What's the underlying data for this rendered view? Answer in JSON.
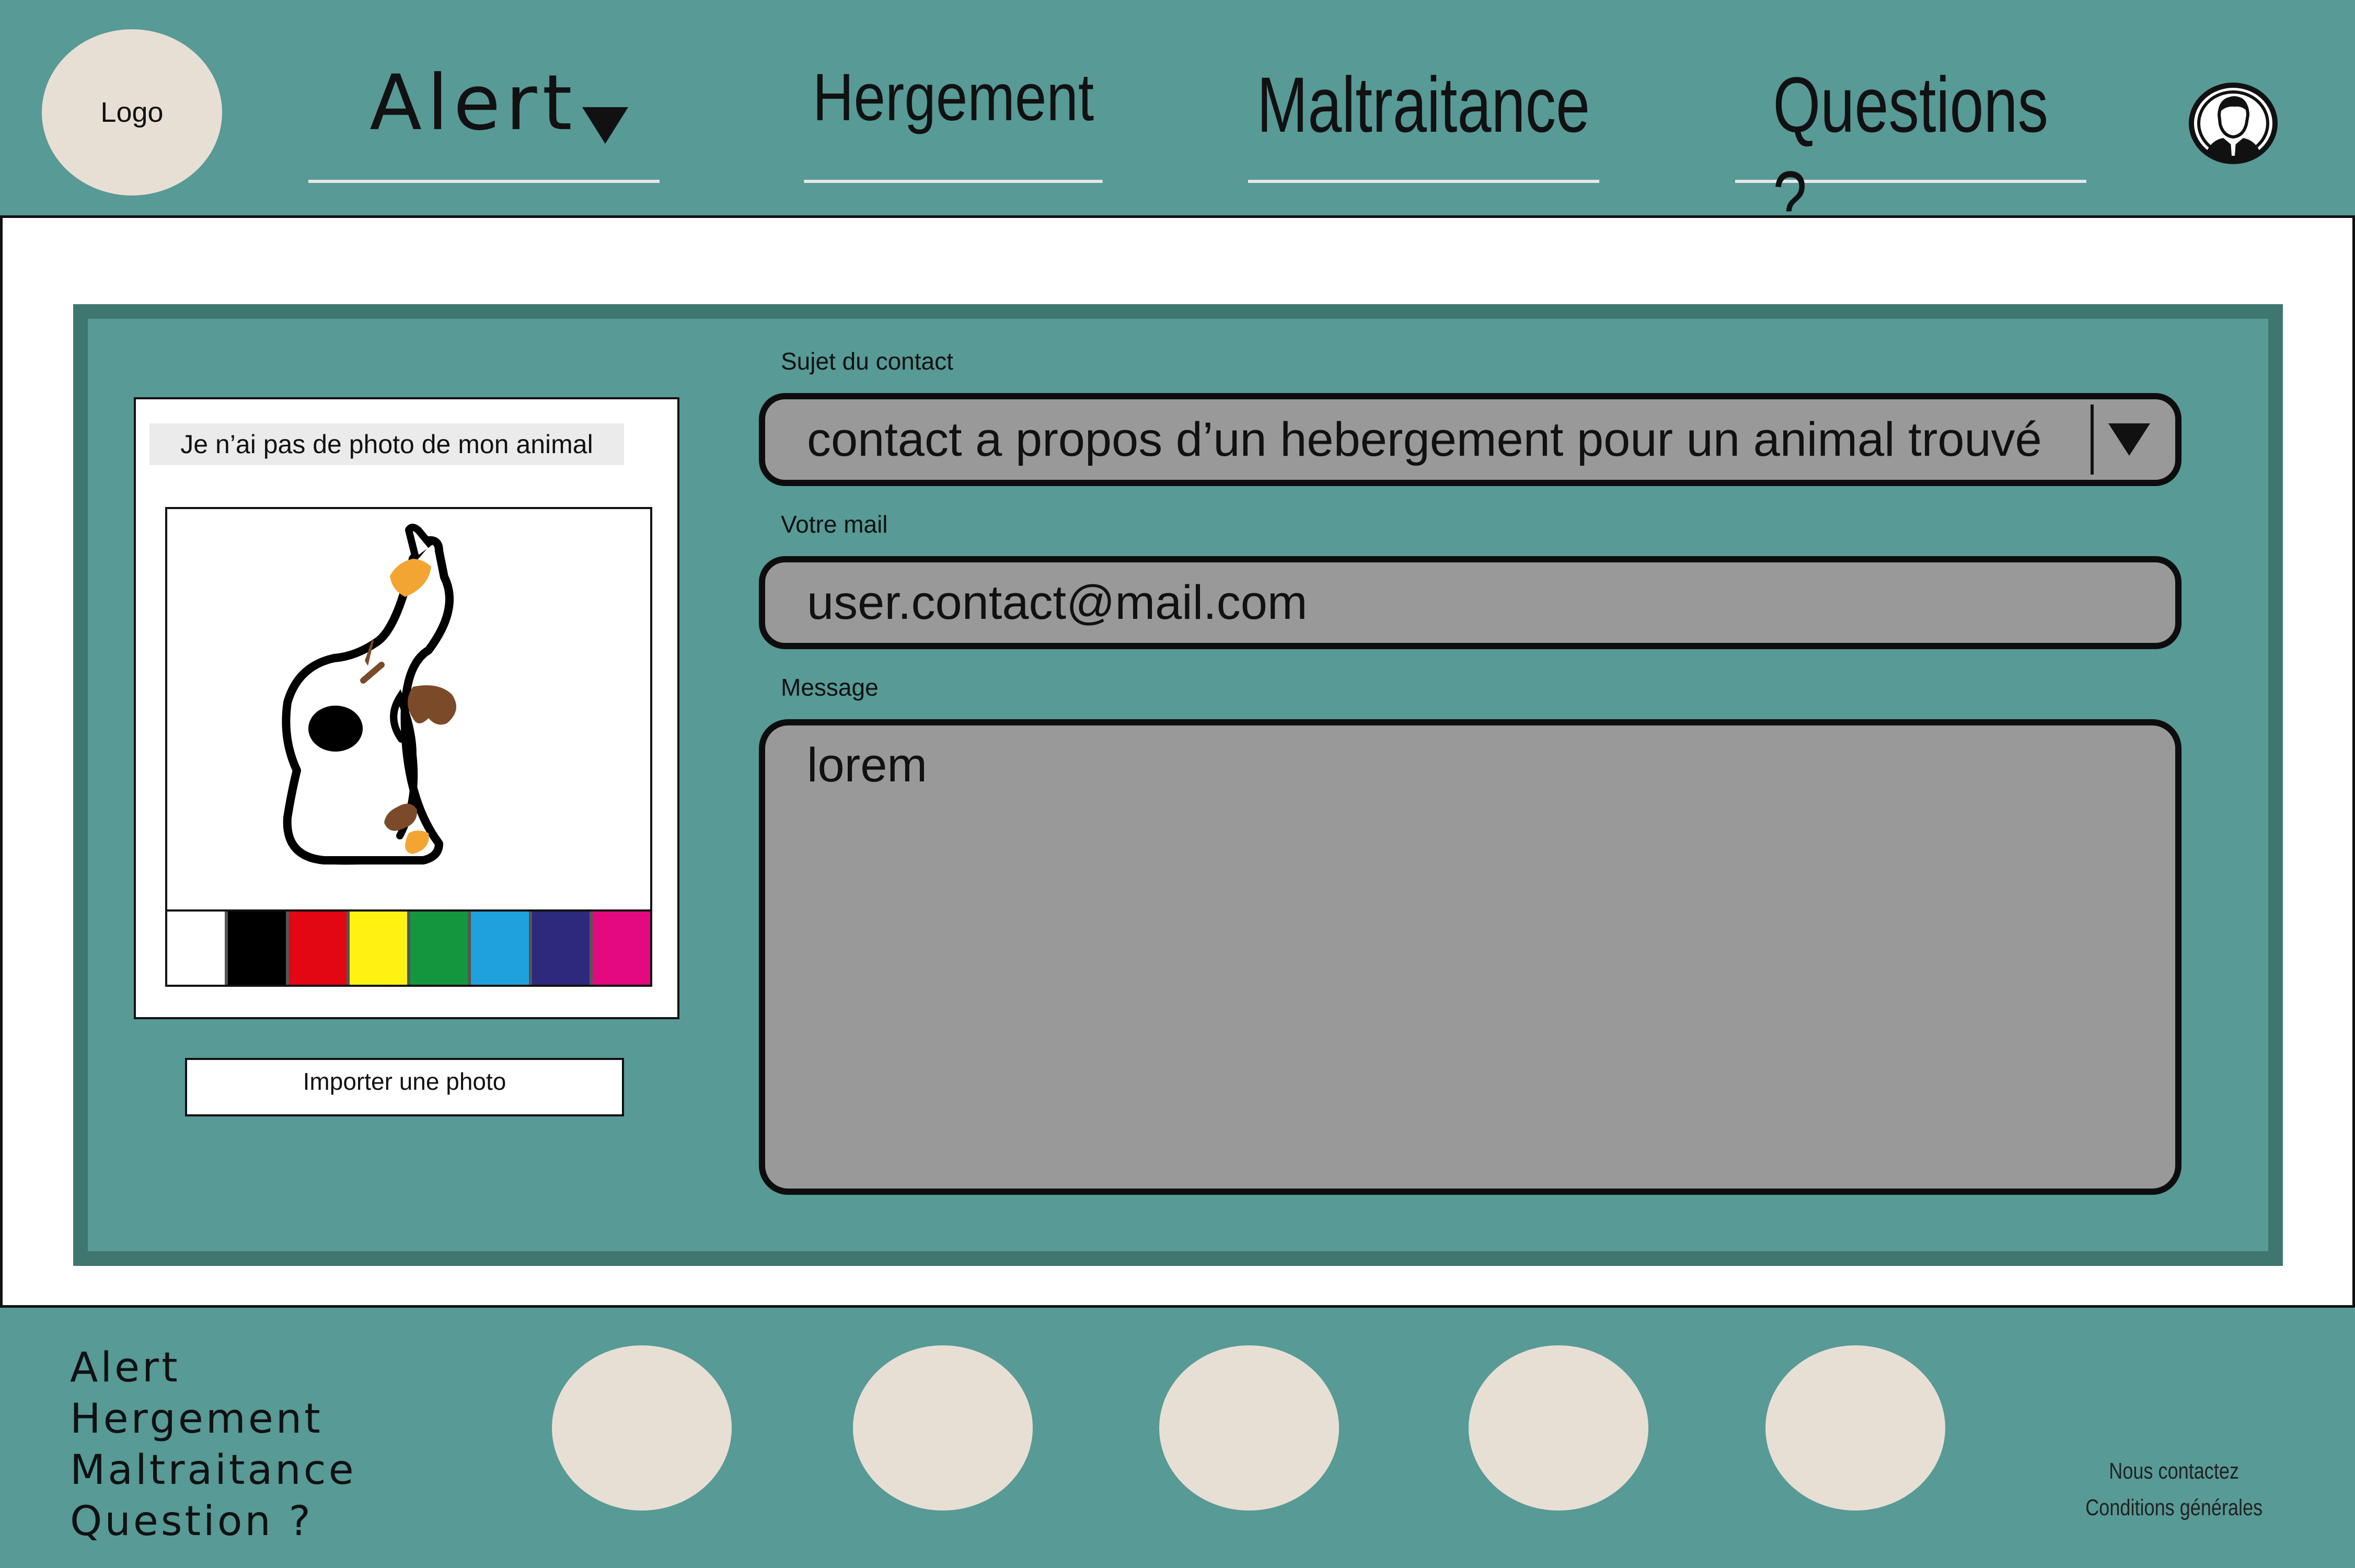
{
  "header": {
    "logo_label": "Logo",
    "nav": [
      {
        "label": "Alert"
      },
      {
        "label": "Hergement"
      },
      {
        "label": "Maltraitance"
      },
      {
        "label": "Questions ?"
      }
    ],
    "profile_icon": "user-avatar-icon"
  },
  "photo_panel": {
    "no_photo_label": "Je n’ai pas de photo de mon animal",
    "import_label": "Importer une photo",
    "illustration": "calico-cat-icon",
    "palette": [
      "#ffffff",
      "#000000",
      "#e30613",
      "#fff212",
      "#14963e",
      "#1ea1dc",
      "#2d2a7d",
      "#e4097f"
    ]
  },
  "form": {
    "subject_label": "Sujet du contact",
    "subject_value": "contact a propos d’un hebergement pour un animal trouvé",
    "mail_label": "Votre mail",
    "mail_value": "user.contact@mail.com",
    "message_label": "Message",
    "message_value": "lorem"
  },
  "footer": {
    "links": [
      "Alert",
      "Hergement",
      "Maltraitance",
      "Question ?"
    ],
    "social_circles": 5,
    "contact_label": "Nous contactez",
    "terms_label": "Conditions générales"
  },
  "colors": {
    "teal": "#579a96",
    "teal_dark": "#3f7670",
    "beige": "#e8dfd4",
    "field_grey": "#999999"
  }
}
